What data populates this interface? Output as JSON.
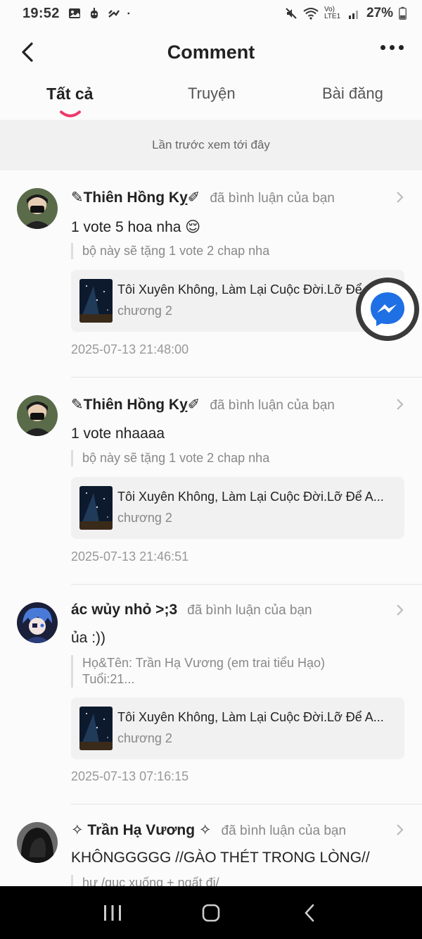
{
  "status_bar": {
    "time": "19:52",
    "battery": "27%",
    "network": "Vo) LTE1"
  },
  "header": {
    "title": "Comment",
    "back_icon": "chevron-left-icon",
    "more_icon": "more-horizontal-icon"
  },
  "tabs": [
    {
      "label": "Tất cả",
      "active": true
    },
    {
      "label": "Truyện",
      "active": false
    },
    {
      "label": "Bài đăng",
      "active": false
    }
  ],
  "notice": "Lần trước xem tới đây",
  "comments": [
    {
      "author": "✎Thiên Hồng Kỵ✐",
      "action": "đã bình luận của bạn",
      "text": "1 vote 5 hoa nha 😌",
      "quote": "bộ này sẽ tặng 1 vote 2 chap nha",
      "story_title": "Tôi Xuyên Không, Làm Lại Cuộc Đời.Lỡ Để A...",
      "chapter": "chương 2",
      "timestamp": "2025-07-13 21:48:00"
    },
    {
      "author": "✎Thiên Hồng Kỵ✐",
      "action": "đã bình luận của bạn",
      "text": "1 vote nhaaaa",
      "quote": "bộ này sẽ tặng 1 vote 2 chap nha",
      "story_title": "Tôi Xuyên Không, Làm Lại Cuộc Đời.Lỡ Để A...",
      "chapter": "chương 2",
      "timestamp": "2025-07-13 21:46:51"
    },
    {
      "author": "ác wủy nhỏ >;3",
      "action": "đã bình luận của bạn",
      "text": "ủa :))",
      "quote": "Họ&Tên: Trần Hạ Vương (em trai tiểu Hạo)",
      "quote2": "Tuổi:21...",
      "story_title": "Tôi Xuyên Không, Làm Lại Cuộc Đời.Lỡ Để A...",
      "chapter": "chương 2",
      "timestamp": "2025-07-13 07:16:15"
    },
    {
      "author": "✧ Trần Hạ Vương ✧",
      "action": "đã bình luận của bạn",
      "text": "KHÔNGGGGG //GÀO THÉT TRONG LÒNG//",
      "quote": "hư /gục xuống + ngất đi/"
    }
  ],
  "colors": {
    "accent": "#f0386b",
    "messenger_blue": "#1f6fe5",
    "background": "#fbfbfb",
    "muted_text": "#888888"
  }
}
